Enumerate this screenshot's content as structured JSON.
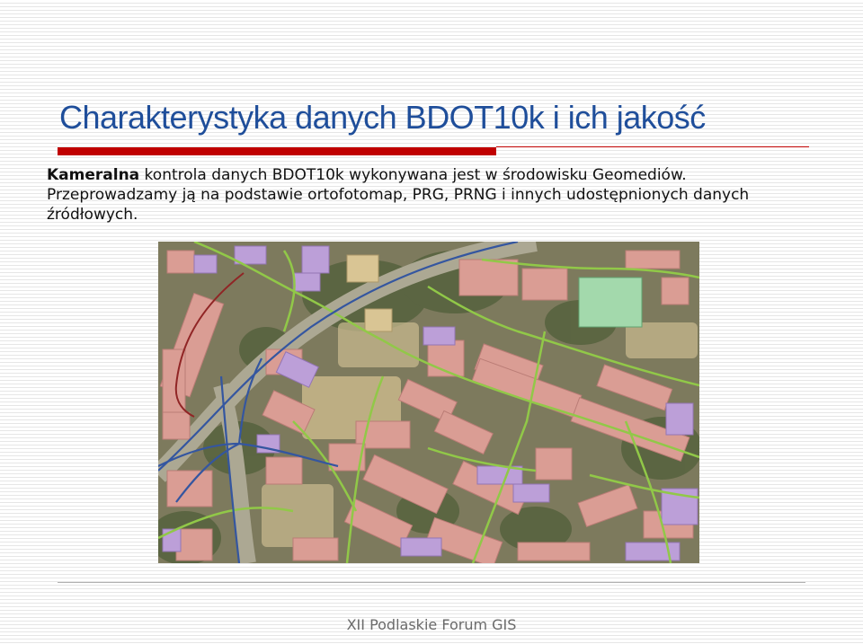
{
  "slide": {
    "title": "Charakterystyka danych BDOT10k i ich jakość",
    "para1_bold": "Kameralna",
    "para1_rest": " kontrola danych BDOT10k wykonywana jest w środowisku Geomediów.",
    "para2": "Przeprowadzamy ją na podstawie ortofotomap, PRG, PRNG i innych udostępnionych danych źródłowych.",
    "footer": "XII Podlaskie Forum GIS"
  },
  "map": {
    "description_colors": {
      "building_existing": "#d9988f",
      "building_new": "#b99ad6",
      "road_lines": "#8cc63f",
      "blue_lines": "#2a4d9b",
      "dark_red_line": "#8b1a1a"
    }
  }
}
